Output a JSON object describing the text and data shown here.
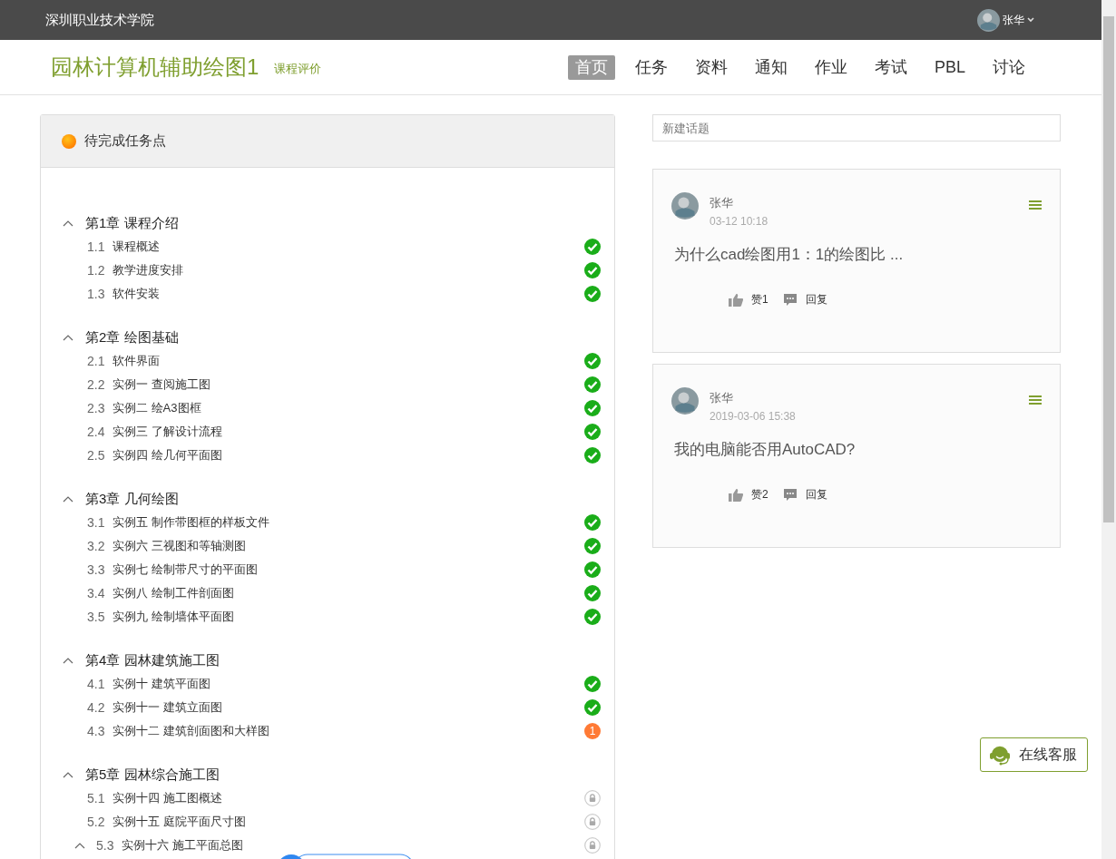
{
  "topbar": {
    "school": "深圳职业技术学院",
    "user": "张华"
  },
  "course": {
    "title": "园林计算机辅助绘图1",
    "rating_link": "课程评价",
    "nav": [
      {
        "label": "首页",
        "selected": true
      },
      {
        "label": "任务",
        "selected": false
      },
      {
        "label": "资料",
        "selected": false
      },
      {
        "label": "通知",
        "selected": false
      },
      {
        "label": "作业",
        "selected": false
      },
      {
        "label": "考试",
        "selected": false
      },
      {
        "label": "PBL",
        "selected": false
      },
      {
        "label": "讨论",
        "selected": false
      }
    ]
  },
  "tasks": {
    "title": "待完成任务点",
    "chapters": [
      {
        "title": "第1章 课程介绍",
        "expanded": true,
        "lessons": [
          {
            "number": "1.1",
            "title": "课程概述",
            "kind": "done"
          },
          {
            "number": "1.2",
            "title": "教学进度安排",
            "kind": "done"
          },
          {
            "number": "1.3",
            "title": "软件安装",
            "kind": "done"
          }
        ]
      },
      {
        "title": "第2章 绘图基础",
        "expanded": true,
        "lessons": [
          {
            "number": "2.1",
            "title": "软件界面",
            "kind": "done"
          },
          {
            "number": "2.2",
            "title": "实例一 查阅施工图",
            "kind": "done"
          },
          {
            "number": "2.3",
            "title": "实例二 绘A3图框",
            "kind": "done"
          },
          {
            "number": "2.4",
            "title": "实例三 了解设计流程",
            "kind": "done"
          },
          {
            "number": "2.5",
            "title": "实例四 绘几何平面图",
            "kind": "done"
          }
        ]
      },
      {
        "title": "第3章 几何绘图",
        "expanded": true,
        "lessons": [
          {
            "number": "3.1",
            "title": "实例五 制作带图框的样板文件",
            "kind": "done"
          },
          {
            "number": "3.2",
            "title": "实例六 三视图和等轴测图",
            "kind": "done"
          },
          {
            "number": "3.3",
            "title": "实例七 绘制带尺寸的平面图",
            "kind": "done"
          },
          {
            "number": "3.4",
            "title": "实例八 绘制工件剖面图",
            "kind": "done"
          },
          {
            "number": "3.5",
            "title": "实例九 绘制墙体平面图",
            "kind": "done"
          }
        ]
      },
      {
        "title": "第4章 园林建筑施工图",
        "expanded": true,
        "lessons": [
          {
            "number": "4.1",
            "title": "实例十 建筑平面图",
            "kind": "done"
          },
          {
            "number": "4.2",
            "title": "实例十一 建筑立面图",
            "kind": "done"
          },
          {
            "number": "4.3",
            "title": "实例十二 建筑剖面图和大样图",
            "kind": "pending",
            "count": "1"
          }
        ]
      },
      {
        "title": "第5章 园林综合施工图",
        "expanded": true,
        "lessons": [
          {
            "number": "5.1",
            "title": "实例十四 施工图概述",
            "kind": "locked",
            "expandable": false
          },
          {
            "number": "5.2",
            "title": "实例十五 庭院平面尺寸图",
            "kind": "locked",
            "expandable": false
          },
          {
            "number": "5.3",
            "title": "实例十六 施工平面总图",
            "kind": "locked",
            "expandable": true
          }
        ]
      }
    ]
  },
  "discussion": {
    "new_topic_placeholder": "新建话题",
    "posts": [
      {
        "author": "张华",
        "time": "03-12 10:18",
        "text": "为什么cad绘图用1：1的绘图比 ...",
        "likes": "赞1",
        "reply": "回复"
      },
      {
        "author": "张华",
        "time": "2019-03-06 15:38",
        "text": "我的电脑能否用AutoCAD?",
        "likes": "赞2",
        "reply": "回复"
      }
    ]
  },
  "service_button": "在线客服"
}
